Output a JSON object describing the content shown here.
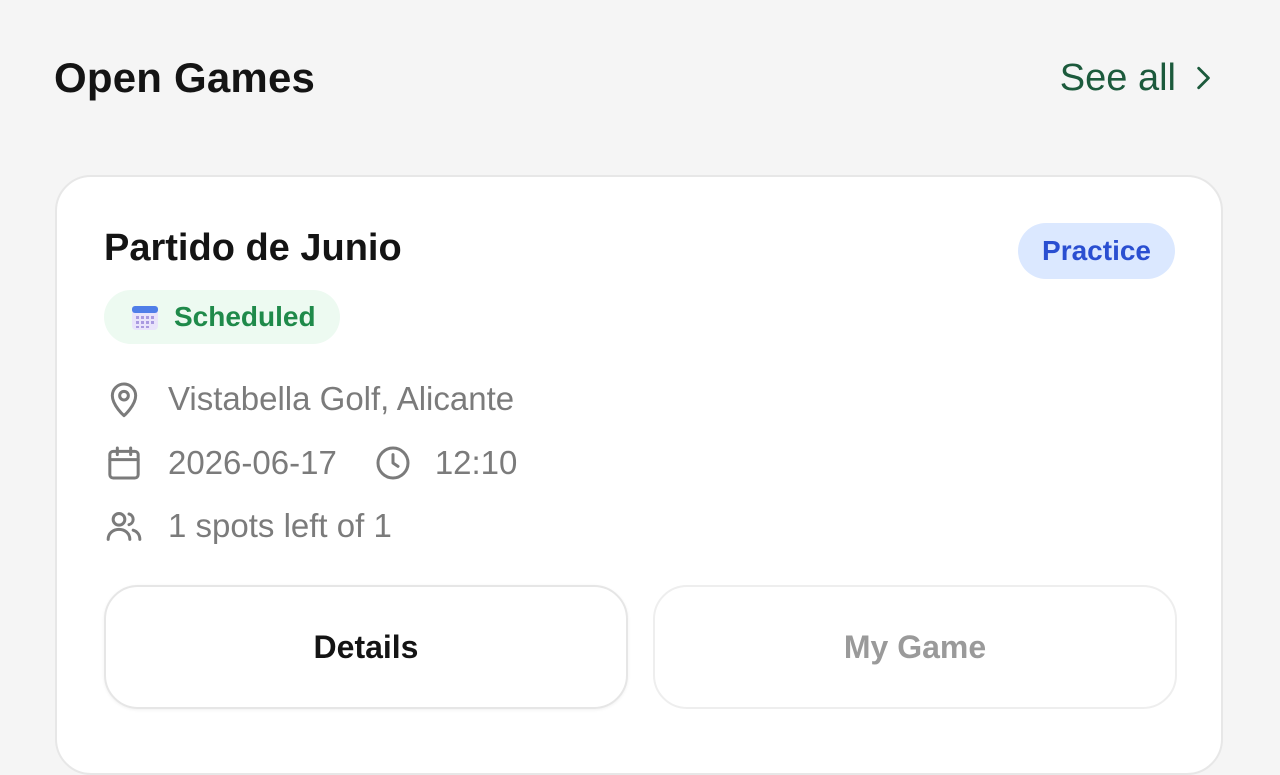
{
  "section": {
    "title": "Open Games",
    "see_all_label": "See all"
  },
  "game": {
    "title": "Partido de Junio",
    "type_badge": "Practice",
    "status_badge": "Scheduled",
    "location": "Vistabella Golf, Alicante",
    "date": "2026-06-17",
    "time": "12:10",
    "spots": "1 spots left of 1"
  },
  "actions": {
    "details_label": "Details",
    "my_game_label": "My Game"
  },
  "icons": {
    "see_all": "chevron-right-icon",
    "status": "calendar-emoji-icon",
    "location": "map-pin-icon",
    "date": "calendar-icon",
    "time": "clock-icon",
    "spots": "users-icon"
  },
  "colors": {
    "accent_green": "#1c5a3c",
    "type_badge_bg": "#dbe8ff",
    "type_badge_text": "#2a4fd1",
    "status_bg": "#edfaf1",
    "status_text": "#1f8a4a"
  }
}
